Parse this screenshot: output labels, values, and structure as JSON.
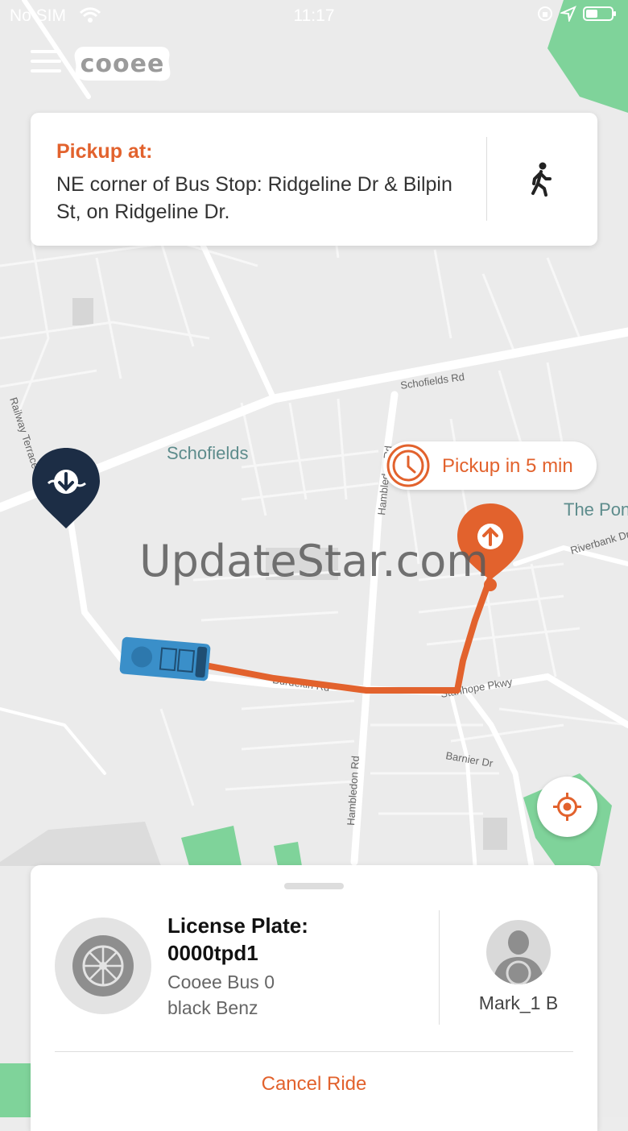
{
  "status_bar": {
    "carrier": "No SIM",
    "time": "11:17",
    "icons": [
      "wifi-icon",
      "orientation-lock-icon",
      "location-arrow-icon",
      "battery-icon"
    ]
  },
  "header": {
    "menu_icon": "hamburger-menu-icon",
    "logo_text": "cooee"
  },
  "pickup": {
    "title": "Pickup at:",
    "address": "NE corner of Bus Stop: Ridgeline Dr & Bilpin St, on Ridgeline Dr.",
    "walk_icon": "walking-person-icon"
  },
  "map": {
    "labels": {
      "schofields_rd": "Schofields Rd",
      "schofields": "Schofields",
      "railway_terrace": "Railway Terrace",
      "hambledon_upper": "Hambledon Rd",
      "hambledon_lower": "Hambledon Rd",
      "the_ponds": "The Ponds",
      "riverbank": "Riverbank Dr",
      "burdekin": "Burdekin Rd",
      "stanhope": "Stanhope Pkwy",
      "barnier": "Barnier Dr"
    },
    "eta_text": "Pickup in 5 min",
    "watermark": "UpdateStar.com",
    "colors": {
      "route": "#e2622d",
      "bus": "#3a8fc9",
      "dropoff_pin": "#1c2d45",
      "pickup_pin": "#e2622d",
      "park": "#7fd39a"
    }
  },
  "ride": {
    "license_label": "License Plate:",
    "license_value": "0000tpd1",
    "vehicle_name": "Cooee Bus 0",
    "vehicle_desc": "black Benz",
    "driver_name": "Mark_1 B",
    "cancel_label": "Cancel Ride"
  }
}
